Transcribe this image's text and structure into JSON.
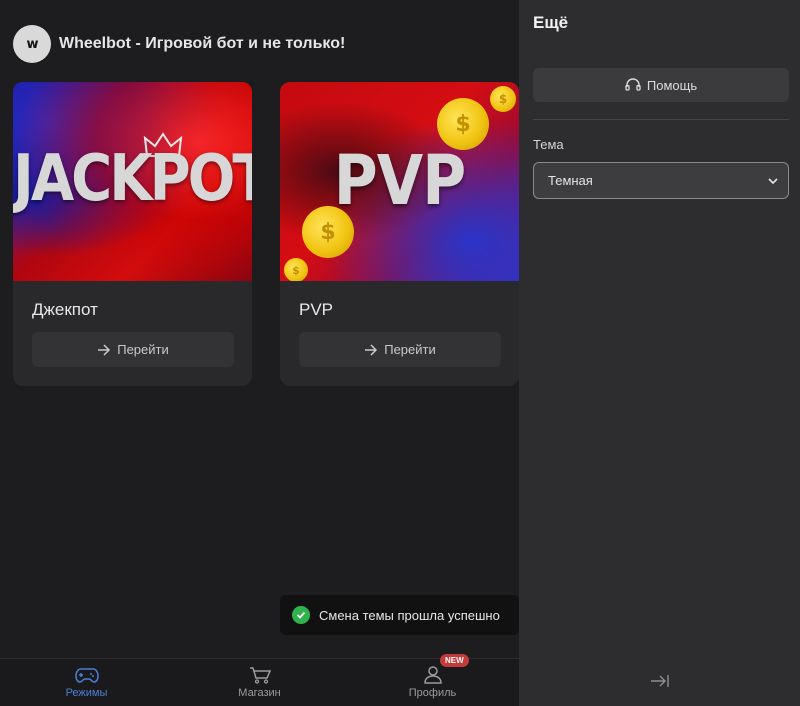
{
  "header": {
    "logo_text": "w",
    "title": "Wheelbot - Игровой бот и не только!"
  },
  "cards": [
    {
      "banner_text": "JACKPOT",
      "title": "Джекпот",
      "button_label": "Перейти"
    },
    {
      "banner_text": "PVP",
      "title": "PVP",
      "button_label": "Перейти"
    }
  ],
  "toast": {
    "message": "Смена темы прошла успешно",
    "icon": "check-circle-icon",
    "color": "#2fb24c"
  },
  "bottom_nav": {
    "items": [
      {
        "label": "Режимы",
        "icon": "gamepad-icon",
        "active": true
      },
      {
        "label": "Магазин",
        "icon": "cart-icon",
        "active": false
      },
      {
        "label": "Профиль",
        "icon": "user-icon",
        "active": false,
        "badge": "NEW"
      }
    ],
    "active_color": "#4a7fd6"
  },
  "panel": {
    "title": "Ещё",
    "help_label": "Помощь",
    "theme_label": "Тема",
    "theme_value": "Темная"
  }
}
